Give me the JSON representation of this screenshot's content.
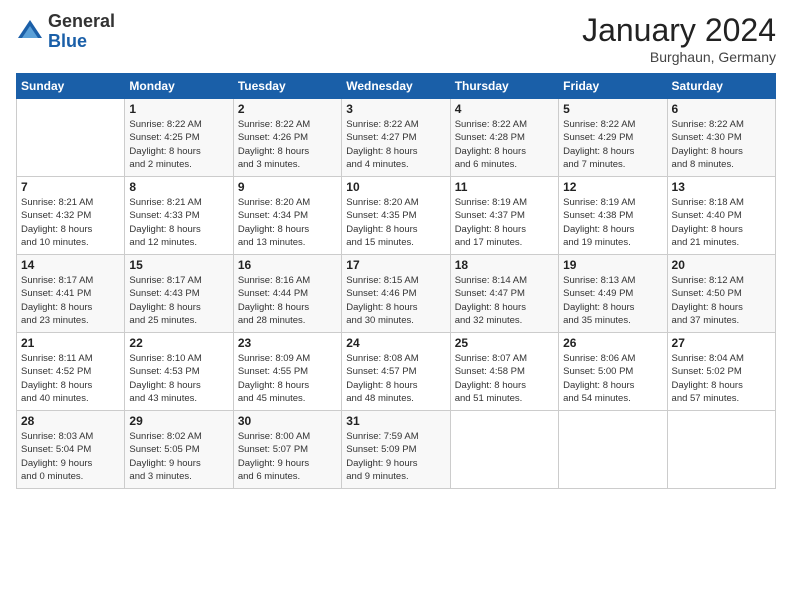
{
  "header": {
    "logo_general": "General",
    "logo_blue": "Blue",
    "title": "January 2024",
    "location": "Burghaun, Germany"
  },
  "days_of_week": [
    "Sunday",
    "Monday",
    "Tuesday",
    "Wednesday",
    "Thursday",
    "Friday",
    "Saturday"
  ],
  "weeks": [
    [
      {
        "day": "",
        "info": ""
      },
      {
        "day": "1",
        "info": "Sunrise: 8:22 AM\nSunset: 4:25 PM\nDaylight: 8 hours\nand 2 minutes."
      },
      {
        "day": "2",
        "info": "Sunrise: 8:22 AM\nSunset: 4:26 PM\nDaylight: 8 hours\nand 3 minutes."
      },
      {
        "day": "3",
        "info": "Sunrise: 8:22 AM\nSunset: 4:27 PM\nDaylight: 8 hours\nand 4 minutes."
      },
      {
        "day": "4",
        "info": "Sunrise: 8:22 AM\nSunset: 4:28 PM\nDaylight: 8 hours\nand 6 minutes."
      },
      {
        "day": "5",
        "info": "Sunrise: 8:22 AM\nSunset: 4:29 PM\nDaylight: 8 hours\nand 7 minutes."
      },
      {
        "day": "6",
        "info": "Sunrise: 8:22 AM\nSunset: 4:30 PM\nDaylight: 8 hours\nand 8 minutes."
      }
    ],
    [
      {
        "day": "7",
        "info": "Sunrise: 8:21 AM\nSunset: 4:32 PM\nDaylight: 8 hours\nand 10 minutes."
      },
      {
        "day": "8",
        "info": "Sunrise: 8:21 AM\nSunset: 4:33 PM\nDaylight: 8 hours\nand 12 minutes."
      },
      {
        "day": "9",
        "info": "Sunrise: 8:20 AM\nSunset: 4:34 PM\nDaylight: 8 hours\nand 13 minutes."
      },
      {
        "day": "10",
        "info": "Sunrise: 8:20 AM\nSunset: 4:35 PM\nDaylight: 8 hours\nand 15 minutes."
      },
      {
        "day": "11",
        "info": "Sunrise: 8:19 AM\nSunset: 4:37 PM\nDaylight: 8 hours\nand 17 minutes."
      },
      {
        "day": "12",
        "info": "Sunrise: 8:19 AM\nSunset: 4:38 PM\nDaylight: 8 hours\nand 19 minutes."
      },
      {
        "day": "13",
        "info": "Sunrise: 8:18 AM\nSunset: 4:40 PM\nDaylight: 8 hours\nand 21 minutes."
      }
    ],
    [
      {
        "day": "14",
        "info": "Sunrise: 8:17 AM\nSunset: 4:41 PM\nDaylight: 8 hours\nand 23 minutes."
      },
      {
        "day": "15",
        "info": "Sunrise: 8:17 AM\nSunset: 4:43 PM\nDaylight: 8 hours\nand 25 minutes."
      },
      {
        "day": "16",
        "info": "Sunrise: 8:16 AM\nSunset: 4:44 PM\nDaylight: 8 hours\nand 28 minutes."
      },
      {
        "day": "17",
        "info": "Sunrise: 8:15 AM\nSunset: 4:46 PM\nDaylight: 8 hours\nand 30 minutes."
      },
      {
        "day": "18",
        "info": "Sunrise: 8:14 AM\nSunset: 4:47 PM\nDaylight: 8 hours\nand 32 minutes."
      },
      {
        "day": "19",
        "info": "Sunrise: 8:13 AM\nSunset: 4:49 PM\nDaylight: 8 hours\nand 35 minutes."
      },
      {
        "day": "20",
        "info": "Sunrise: 8:12 AM\nSunset: 4:50 PM\nDaylight: 8 hours\nand 37 minutes."
      }
    ],
    [
      {
        "day": "21",
        "info": "Sunrise: 8:11 AM\nSunset: 4:52 PM\nDaylight: 8 hours\nand 40 minutes."
      },
      {
        "day": "22",
        "info": "Sunrise: 8:10 AM\nSunset: 4:53 PM\nDaylight: 8 hours\nand 43 minutes."
      },
      {
        "day": "23",
        "info": "Sunrise: 8:09 AM\nSunset: 4:55 PM\nDaylight: 8 hours\nand 45 minutes."
      },
      {
        "day": "24",
        "info": "Sunrise: 8:08 AM\nSunset: 4:57 PM\nDaylight: 8 hours\nand 48 minutes."
      },
      {
        "day": "25",
        "info": "Sunrise: 8:07 AM\nSunset: 4:58 PM\nDaylight: 8 hours\nand 51 minutes."
      },
      {
        "day": "26",
        "info": "Sunrise: 8:06 AM\nSunset: 5:00 PM\nDaylight: 8 hours\nand 54 minutes."
      },
      {
        "day": "27",
        "info": "Sunrise: 8:04 AM\nSunset: 5:02 PM\nDaylight: 8 hours\nand 57 minutes."
      }
    ],
    [
      {
        "day": "28",
        "info": "Sunrise: 8:03 AM\nSunset: 5:04 PM\nDaylight: 9 hours\nand 0 minutes."
      },
      {
        "day": "29",
        "info": "Sunrise: 8:02 AM\nSunset: 5:05 PM\nDaylight: 9 hours\nand 3 minutes."
      },
      {
        "day": "30",
        "info": "Sunrise: 8:00 AM\nSunset: 5:07 PM\nDaylight: 9 hours\nand 6 minutes."
      },
      {
        "day": "31",
        "info": "Sunrise: 7:59 AM\nSunset: 5:09 PM\nDaylight: 9 hours\nand 9 minutes."
      },
      {
        "day": "",
        "info": ""
      },
      {
        "day": "",
        "info": ""
      },
      {
        "day": "",
        "info": ""
      }
    ]
  ]
}
